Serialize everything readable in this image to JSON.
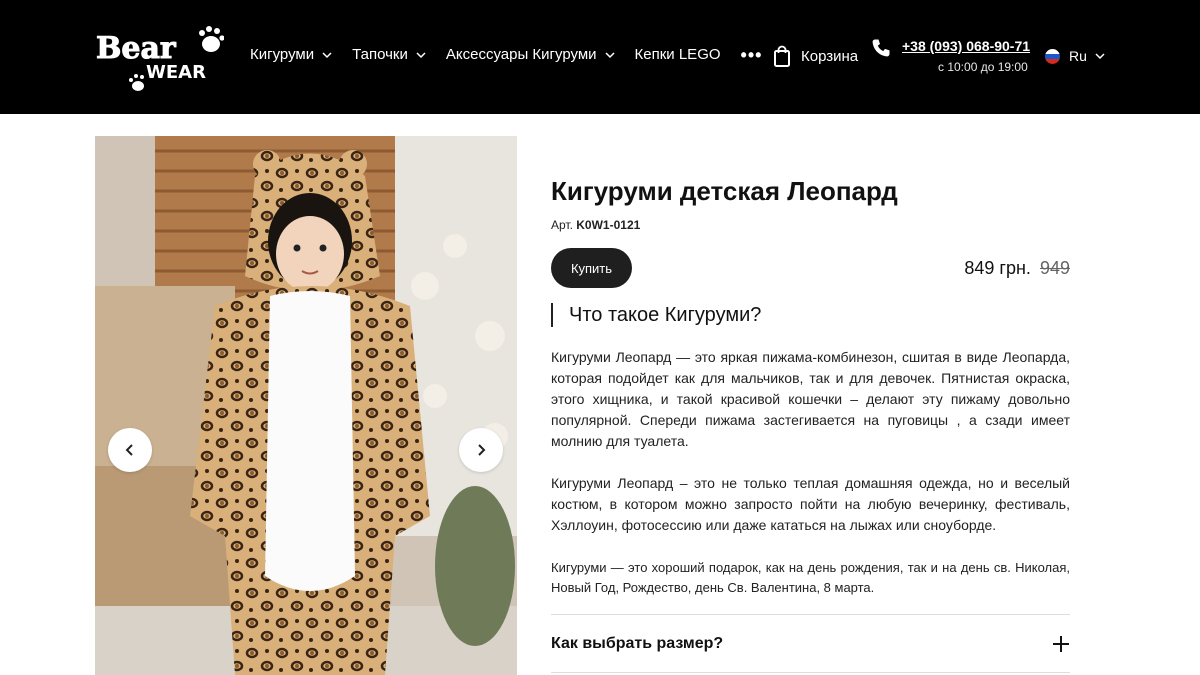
{
  "header": {
    "logo_text_top": "Bear",
    "logo_text_bottom": "WEAR",
    "nav": [
      {
        "label": "Кигуруми"
      },
      {
        "label": "Тапочки"
      },
      {
        "label": "Аксессуары Кигуруми"
      },
      {
        "label": "Кепки LEGO"
      }
    ],
    "more_label": "•••",
    "cart_label": "Корзина",
    "phone": "+38 (093) 068-90-71",
    "hours": "с 10:00 до 19:00",
    "language": "Ru"
  },
  "product": {
    "title": "Кигуруми детская Леопард",
    "sku_label": "Арт.",
    "sku": "K0W1-0121",
    "buy_label": "Купить",
    "price": "849 грн.",
    "old_price": "949",
    "section_title": "Что такое Кигуруми?",
    "paragraphs": [
      "Кигуруми Леопард — это яркая пижама-комбинезон, сшитая в виде Леопарда, которая подойдет как для мальчиков, так и для девочек. Пятнистая окраска, этого хищника, и такой красивой кошечки  – делают эту пижаму довольно популярной. Спереди пижама застегивается на пуговицы , а сзади имеет молнию для туалета.",
      "Кигуруми Леопард – это не только теплая домашняя одежда, но и веселый костюм, в котором можно запросто пойти на любую вечеринку, фестиваль, Хэллоуин, фотосессию или даже кататься на лыжах или сноуборде.",
      "Кигуруми — это хороший подарок, как на день рождения, так и на день св. Николая, Новый Год, Рождество, день Св. Валентина, 8 марта."
    ],
    "accordion_label": "Как выбрать размер?"
  },
  "colors": {
    "header_bg": "#000000",
    "button_bg": "#1f1f1f"
  }
}
